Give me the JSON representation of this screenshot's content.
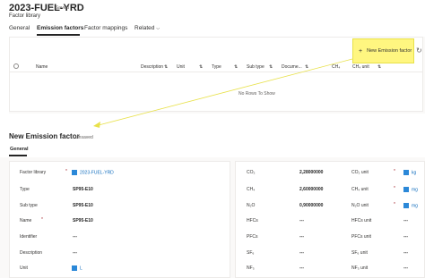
{
  "header": {
    "title": "2023-FUEL-YRD",
    "saved_status": "- Saved",
    "subtitle": "Factor library"
  },
  "tabs": [
    {
      "label": "General"
    },
    {
      "label": "Emission factors"
    },
    {
      "label": "Factor mappings"
    },
    {
      "label": "Related"
    }
  ],
  "grid": {
    "new_button_label": "New Emission factor",
    "columns": [
      "Name",
      "Description",
      "Unit",
      "Type",
      "Sub type",
      "Docume...",
      "CH₄",
      "CH₄ unit"
    ],
    "empty_text": "No Rows To Show"
  },
  "form": {
    "title": "New Emission factor",
    "status": "- Unsaved",
    "tab": "General",
    "left_fields": [
      {
        "label": "Factor library",
        "value": "2023-FUEL-YRD"
      },
      {
        "label": "Type",
        "value": "SP95-E10"
      },
      {
        "label": "Sub type",
        "value": "SP95-E10"
      },
      {
        "label": "Name",
        "value": "SP95-E10"
      },
      {
        "label": "Identifier",
        "value": "---"
      },
      {
        "label": "Description",
        "value": "---"
      },
      {
        "label": "Unit",
        "value": "L"
      }
    ],
    "right_fields": [
      {
        "label": "CO₂",
        "value": "2,28000000",
        "unit_label": "CO₂ unit",
        "unit_value": "kg"
      },
      {
        "label": "CH₄",
        "value": "2,60000000",
        "unit_label": "CH₄ unit",
        "unit_value": "mg"
      },
      {
        "label": "N₂O",
        "value": "0,90000000",
        "unit_label": "N₂O unit",
        "unit_value": "mg"
      },
      {
        "label": "HFCs",
        "value": "---",
        "unit_label": "HFCs unit",
        "unit_value": "---"
      },
      {
        "label": "PFCs",
        "value": "---",
        "unit_label": "PFCs unit",
        "unit_value": "---"
      },
      {
        "label": "SF₆",
        "value": "---",
        "unit_label": "SF₆ unit",
        "unit_value": "---"
      },
      {
        "label": "NF₃",
        "value": "---",
        "unit_label": "NF₃ unit",
        "unit_value": "---"
      }
    ]
  },
  "colors": {
    "highlight": "#fff680",
    "annotation": "#e8e14a",
    "link": "#0f6cbd"
  },
  "icons": {
    "add": "plus-icon",
    "refresh": "refresh-icon",
    "lookup": "entity-icon",
    "search": "search-icon"
  }
}
